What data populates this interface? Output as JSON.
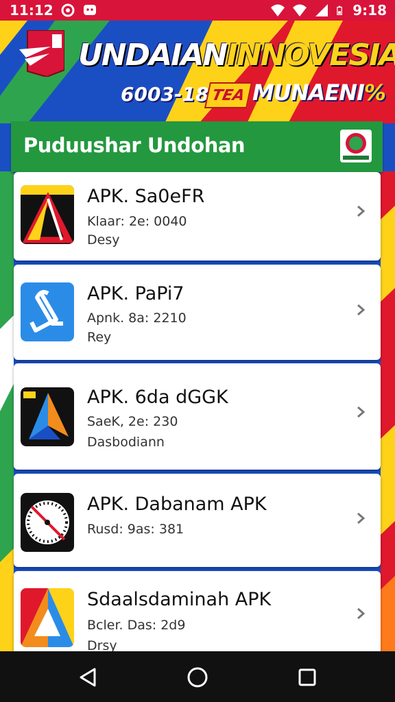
{
  "status_bar": {
    "time_left": "11:12",
    "time_right": "9:18",
    "icons": [
      "circle-notification-icon",
      "message-icon",
      "wifi-icon",
      "signal-icon",
      "battery-icon"
    ]
  },
  "banner": {
    "title_part1": "UNDAIAN",
    "title_part2": "INNOVESIA",
    "year": "6003-18",
    "tag": "TEA",
    "subtitle": "MUNAENI",
    "subtitle_accent": "%",
    "colors": {
      "blue": "#1a4fc4",
      "yellow": "#ffd21a",
      "red": "#e0182c",
      "green": "#2ea44f"
    }
  },
  "card": {
    "title": "Puduushar Undohan",
    "header_color": "#23983f"
  },
  "apps": [
    {
      "name": "APK. Sa0eFR",
      "meta1": "Klaar: 2e: 0040",
      "meta2": "Desy",
      "icon": "red-triangle-app-icon"
    },
    {
      "name": "APK. PaPi7",
      "meta1": "Apnk. 8a: 2210",
      "meta2": "Rey",
      "icon": "blue-recycle-app-icon"
    },
    {
      "name": "APK. 6da dGGK",
      "meta1": "SaeK, 2e: 230",
      "meta2": "Dasbodiann",
      "icon": "blue-arrow-app-icon"
    },
    {
      "name": "APK. Dabanam APK",
      "meta1": "Rusd: 9as: 381",
      "meta2": "",
      "icon": "gauge-app-icon"
    },
    {
      "name": "Sdaalsdaminah APK",
      "meta1": "Bcler. Das: 2d9",
      "meta2": "Drsy",
      "icon": "colorful-triangle-app-icon"
    }
  ],
  "nav": {
    "back": "back-icon",
    "home": "home-icon",
    "recents": "recents-icon"
  }
}
